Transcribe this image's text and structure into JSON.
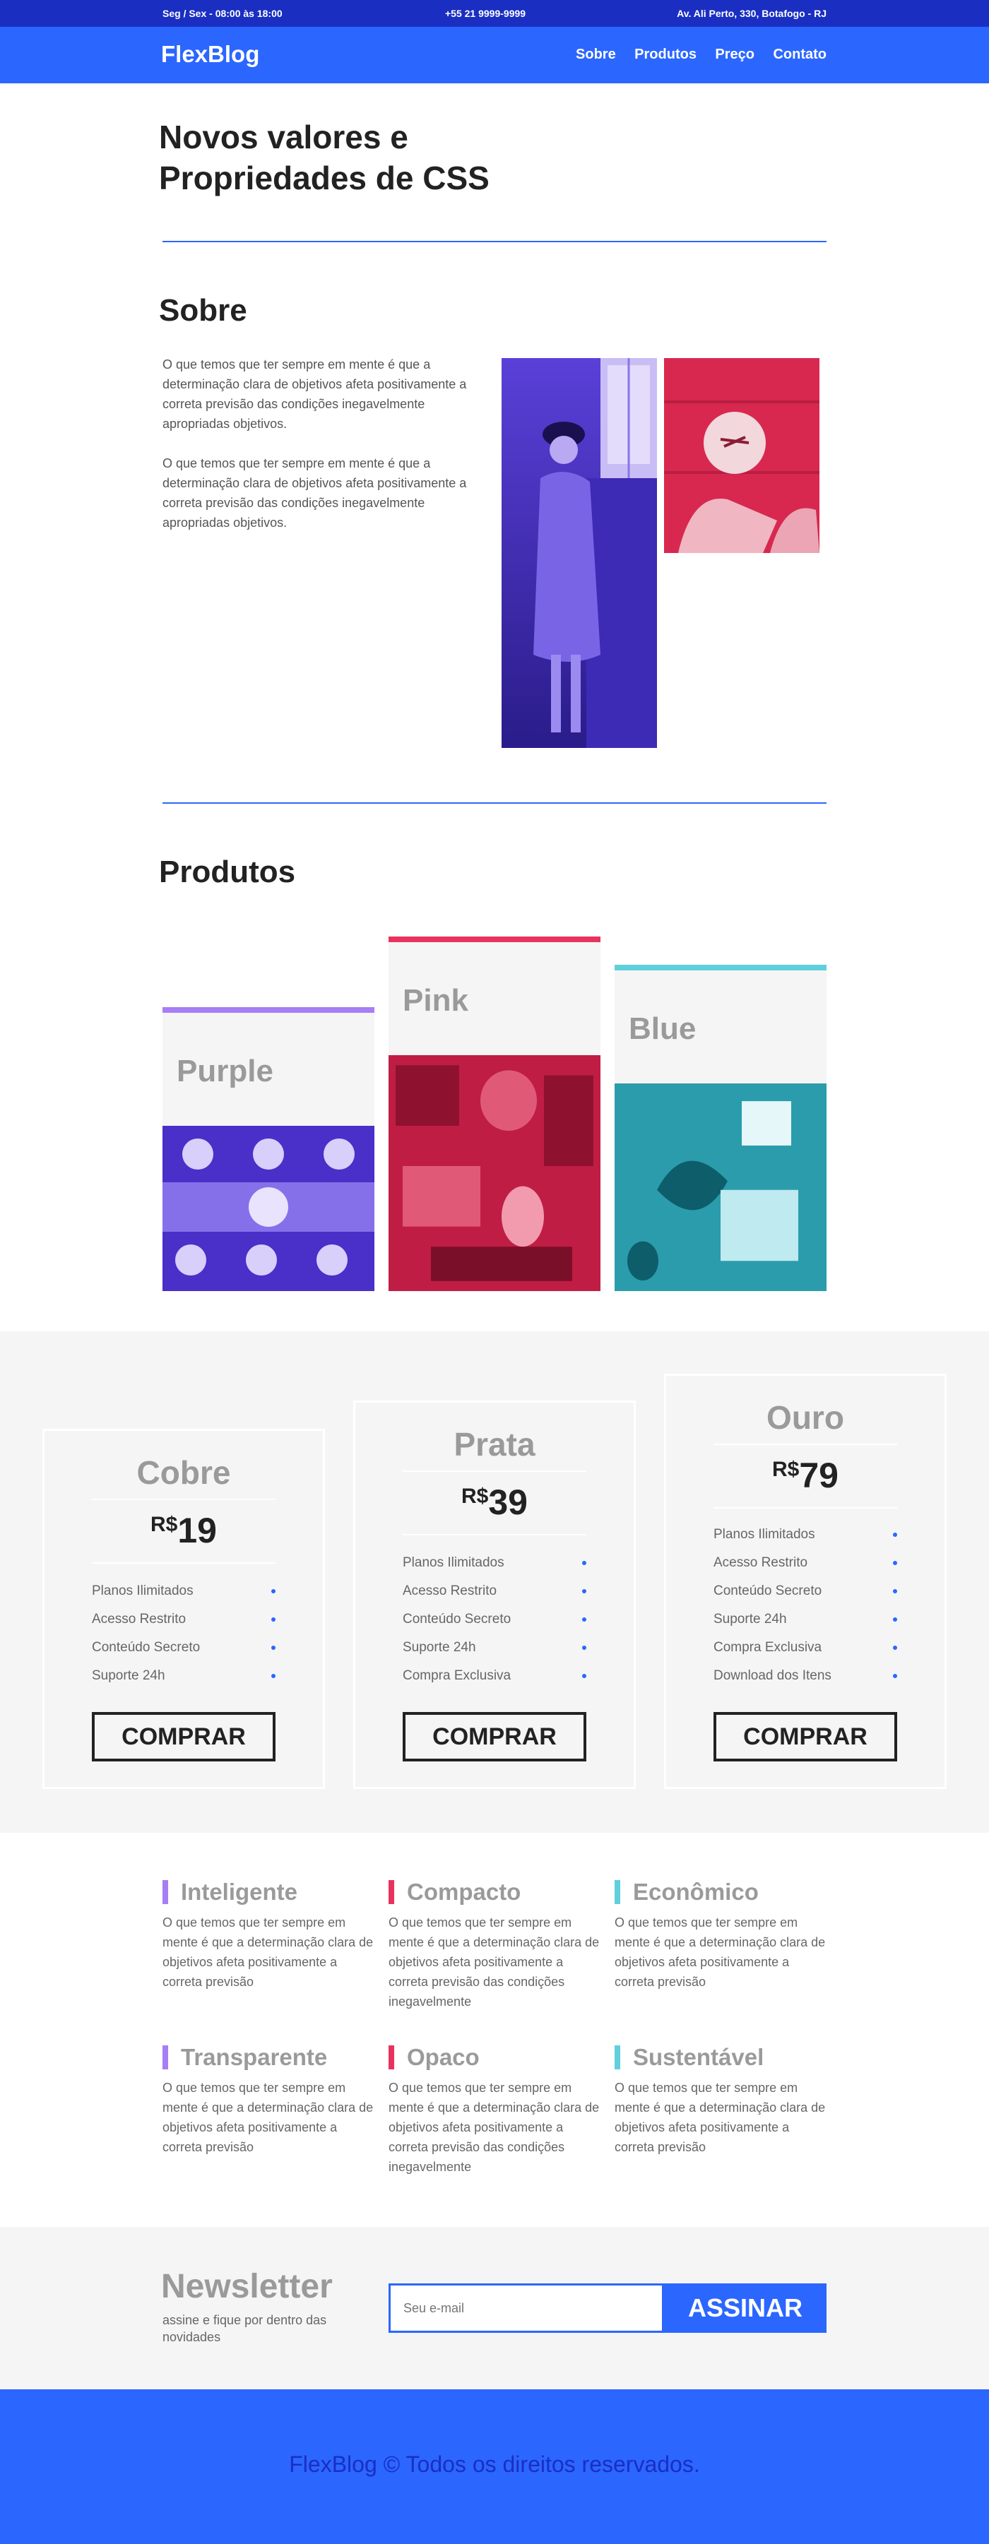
{
  "topbar": {
    "hours": "Seg / Sex - 08:00 às 18:00",
    "phone": "+55 21 9999-9999",
    "address": "Av. Ali Perto, 330, Botafogo - RJ"
  },
  "header": {
    "logo": "FlexBlog",
    "menu": [
      "Sobre",
      "Produtos",
      "Preço",
      "Contato"
    ]
  },
  "hero": {
    "title": "Novos valores e Propriedades de CSS"
  },
  "about": {
    "title": "Sobre",
    "paragraphs": [
      "O que temos que ter sempre em mente é que a determinação clara de objetivos afeta positivamente a correta previsão das condições inegavelmente apropriadas objetivos.",
      "O que temos que ter sempre em mente é que a determinação clara de objetivos afeta positivamente a correta previsão das condições inegavelmente apropriadas objetivos."
    ]
  },
  "products": {
    "title": "Produtos",
    "items": [
      {
        "name": "Purple",
        "color": "#a77ef5"
      },
      {
        "name": "Pink",
        "color": "#e8335f"
      },
      {
        "name": "Blue",
        "color": "#5fd0dc"
      }
    ]
  },
  "pricing": {
    "currency": "R$",
    "buy_label": "COMPRAR",
    "plans": [
      {
        "name": "Cobre",
        "price": "19",
        "features": [
          "Planos Ilimitados",
          "Acesso Restrito",
          "Conteúdo Secreto",
          "Suporte 24h"
        ]
      },
      {
        "name": "Prata",
        "price": "39",
        "features": [
          "Planos Ilimitados",
          "Acesso Restrito",
          "Conteúdo Secreto",
          "Suporte 24h",
          "Compra Exclusiva"
        ]
      },
      {
        "name": "Ouro",
        "price": "79",
        "features": [
          "Planos Ilimitados",
          "Acesso Restrito",
          "Conteúdo Secreto",
          "Suporte 24h",
          "Compra Exclusiva",
          "Download dos Itens"
        ]
      }
    ]
  },
  "features": [
    {
      "title": "Inteligente",
      "color": "#a77ef5",
      "text": "O que temos que ter sempre em mente é que a determinação clara de objetivos afeta positivamente a correta previsão"
    },
    {
      "title": "Compacto",
      "color": "#e8335f",
      "text": "O que temos que ter sempre em mente é que a determinação clara de objetivos afeta positivamente a correta previsão das condições inegavelmente"
    },
    {
      "title": "Econômico",
      "color": "#5fd0dc",
      "text": "O que temos que ter sempre em mente é que a determinação clara de objetivos afeta positivamente a correta previsão"
    },
    {
      "title": "Transparente",
      "color": "#a77ef5",
      "text": "O que temos que ter sempre em mente é que a determinação clara de objetivos afeta positivamente a correta previsão"
    },
    {
      "title": "Opaco",
      "color": "#e8335f",
      "text": "O que temos que ter sempre em mente é que a determinação clara de objetivos afeta positivamente a correta previsão das condições inegavelmente"
    },
    {
      "title": "Sustentável",
      "color": "#5fd0dc",
      "text": "O que temos que ter sempre em mente é que a determinação clara de objetivos afeta positivamente a correta previsão"
    }
  ],
  "newsletter": {
    "title": "Newsletter",
    "subtitle": "assine e fique por dentro das novidades",
    "placeholder": "Seu e-mail",
    "button": "ASSINAR"
  },
  "footer": {
    "text": "FlexBlog © Todos os direitos reservados."
  },
  "colors": {
    "primary": "#2b66ff",
    "dark_blue": "#1a2fc2"
  }
}
